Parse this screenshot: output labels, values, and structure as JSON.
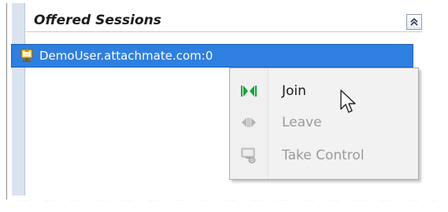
{
  "panel": {
    "title": "Offered Sessions",
    "collapse_icon": "double-chevron-up-icon"
  },
  "session": {
    "label": "DemoUser.attachmate.com:0",
    "icon": "session-share-icon",
    "selected": true
  },
  "context_menu": {
    "items": [
      {
        "label": "Join",
        "icon": "join-icon",
        "enabled": true
      },
      {
        "label": "Leave",
        "icon": "leave-icon",
        "enabled": false
      },
      {
        "label": "Take Control",
        "icon": "take-control-icon",
        "enabled": false
      }
    ]
  },
  "colors": {
    "selection": "#2f7fe0",
    "join_icon": "#17a53a",
    "disabled": "#9a9a9a"
  }
}
